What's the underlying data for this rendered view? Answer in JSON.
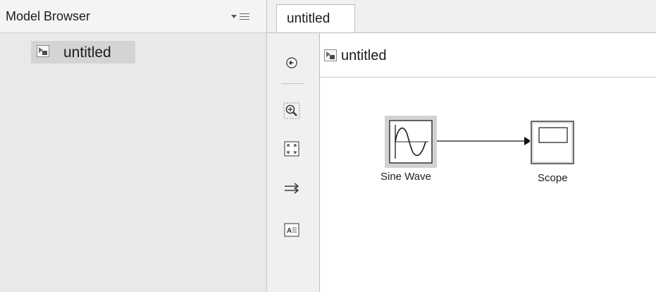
{
  "model_browser": {
    "title": "Model Browser",
    "menu_icon": "dropdown-menu-icon",
    "tree": [
      {
        "label": "untitled",
        "icon": "model-icon",
        "selected": true
      }
    ]
  },
  "editor": {
    "tabs": [
      {
        "label": "untitled",
        "active": true
      }
    ],
    "address_bar": {
      "label": "untitled",
      "icon": "model-icon"
    },
    "toolbar": [
      {
        "name": "navigate-back-icon"
      },
      {
        "name": "zoom-in-icon"
      },
      {
        "name": "fit-to-view-icon"
      },
      {
        "name": "route-lines-icon"
      },
      {
        "name": "annotation-icon"
      }
    ]
  },
  "diagram": {
    "blocks": [
      {
        "id": "sine",
        "label": "Sine Wave",
        "type": "source"
      },
      {
        "id": "scope",
        "label": "Scope",
        "type": "sink"
      }
    ],
    "connections": [
      {
        "from": "sine",
        "to": "scope"
      }
    ]
  }
}
